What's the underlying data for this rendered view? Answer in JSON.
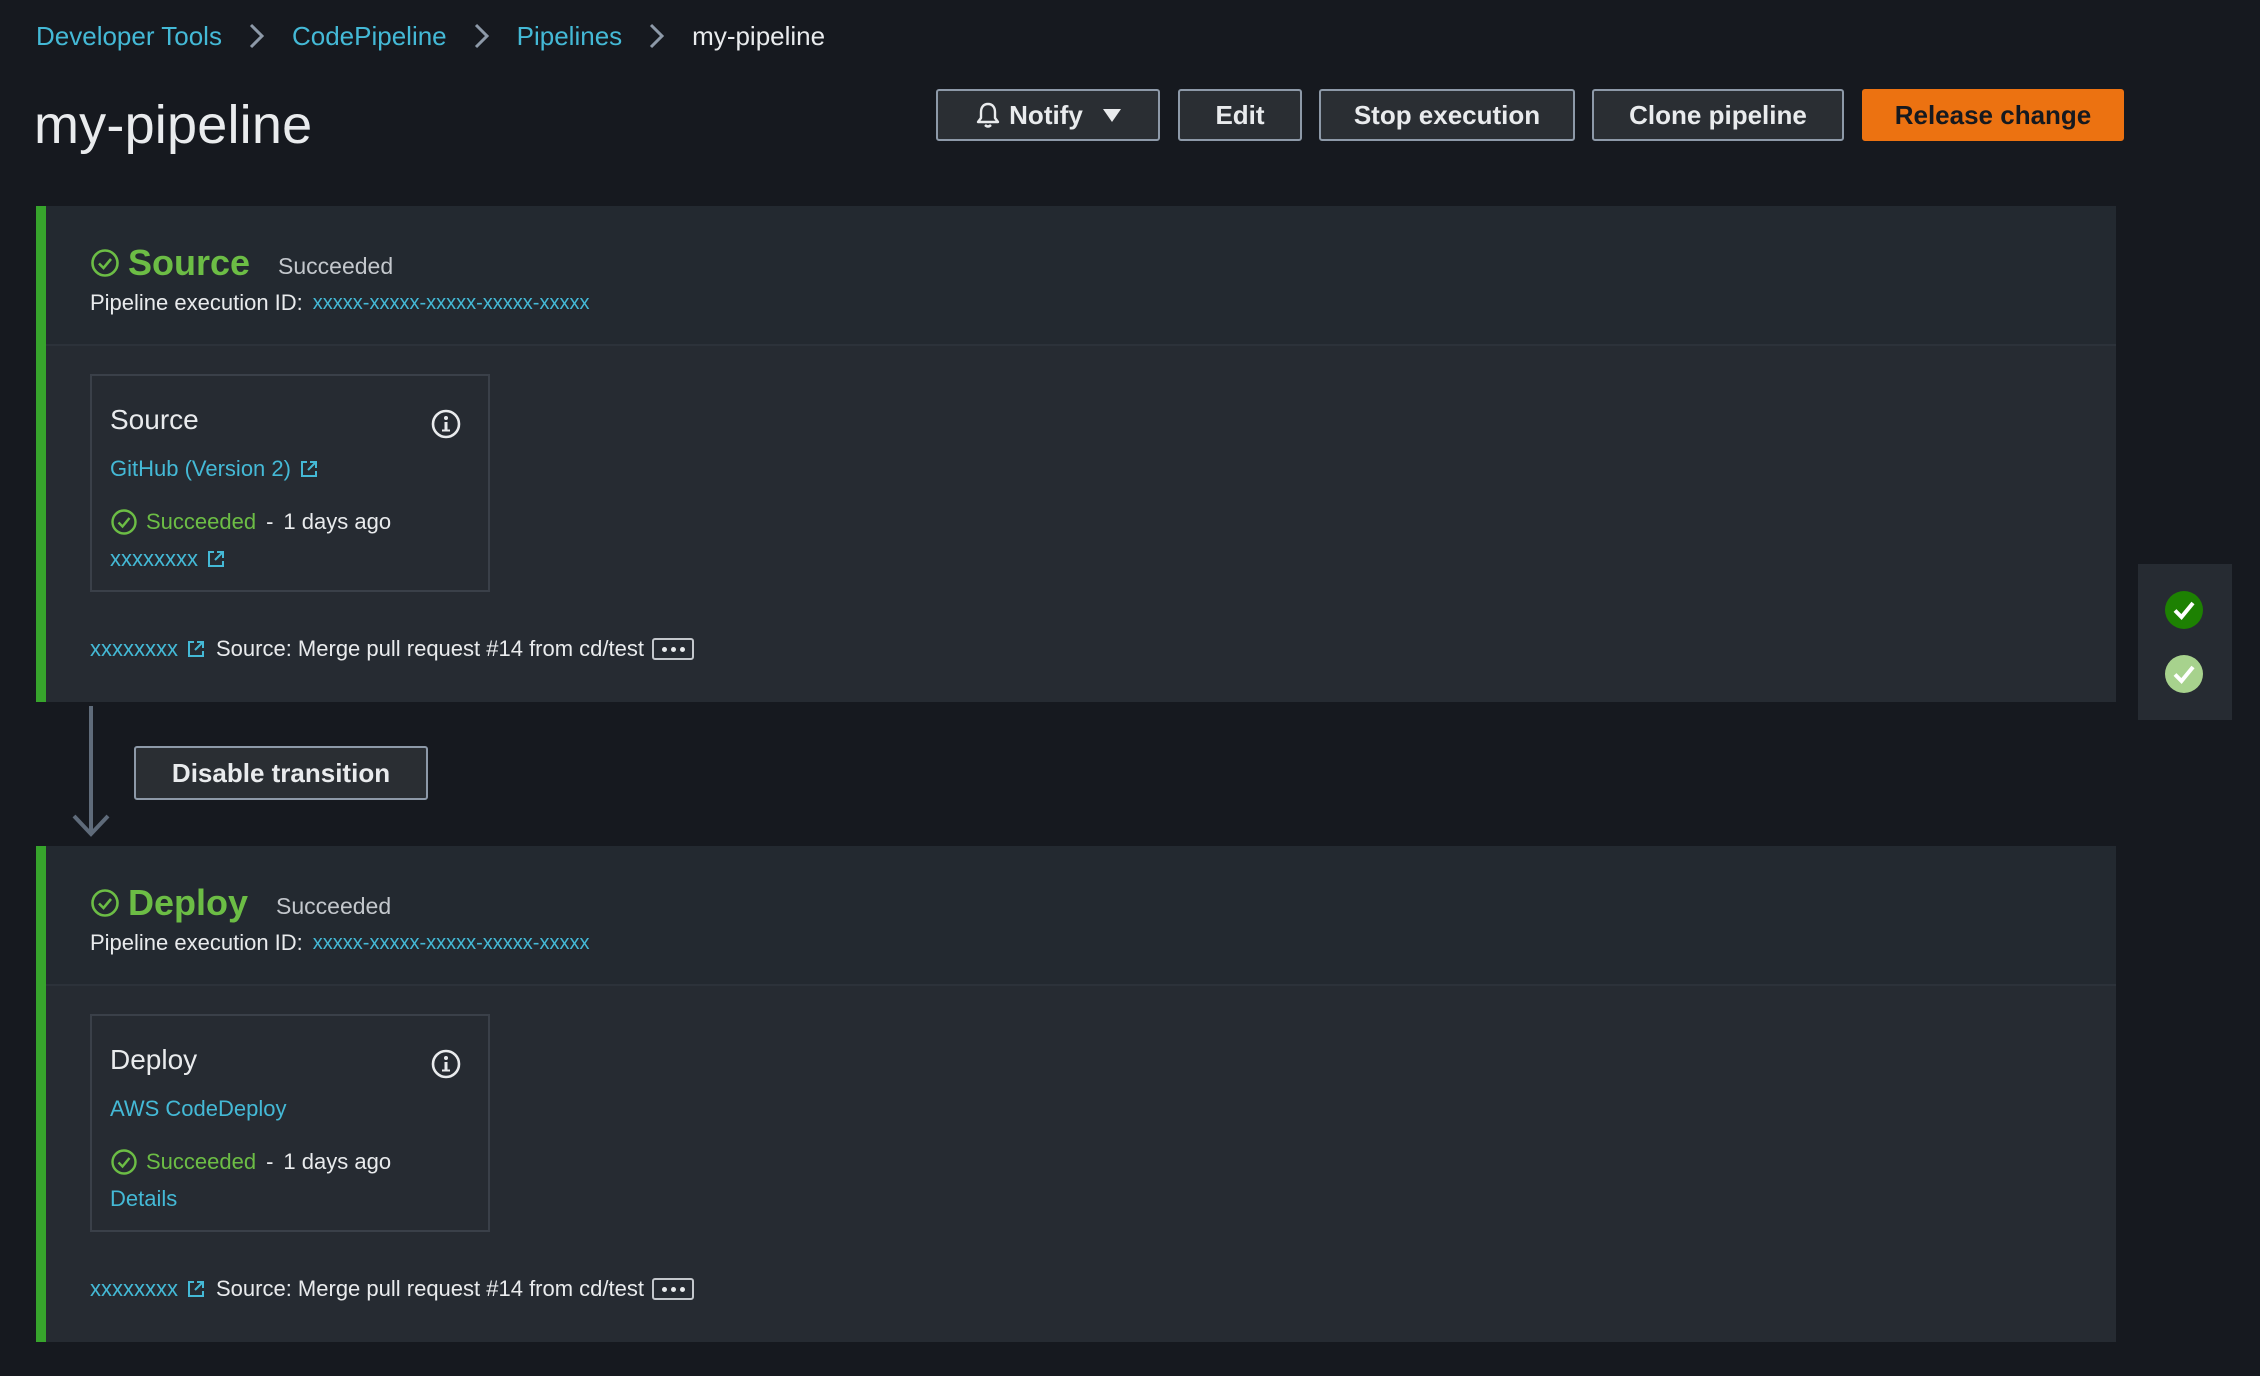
{
  "breadcrumb": {
    "items": [
      {
        "label": "Developer Tools"
      },
      {
        "label": "CodePipeline"
      },
      {
        "label": "Pipelines"
      },
      {
        "label": "my-pipeline"
      }
    ]
  },
  "page": {
    "title": "my-pipeline"
  },
  "header_buttons": {
    "notify": "Notify",
    "edit": "Edit",
    "stop": "Stop execution",
    "clone": "Clone pipeline",
    "release": "Release change"
  },
  "stages": [
    {
      "name": "Source",
      "status": "Succeeded",
      "exec_label": "Pipeline execution ID:",
      "exec_id": "xxxxx-xxxxx-xxxxx-xxxxx-xxxxx",
      "action": {
        "name": "Source",
        "provider": "GitHub (Version 2)",
        "status": "Succeeded",
        "dash": "-",
        "ago": "1 days ago",
        "link": "xxxxxxxx"
      },
      "commit": {
        "id": "xxxxxxxx",
        "message": "Source: Merge pull request #14 from cd/test"
      }
    },
    {
      "name": "Deploy",
      "status": "Succeeded",
      "exec_label": "Pipeline execution ID:",
      "exec_id": "xxxxx-xxxxx-xxxxx-xxxxx-xxxxx",
      "action": {
        "name": "Deploy",
        "provider": "AWS CodeDeploy",
        "status": "Succeeded",
        "dash": "-",
        "ago": "1 days ago",
        "link": "Details"
      },
      "commit": {
        "id": "xxxxxxxx",
        "message": "Source: Merge pull request #14 from cd/test"
      }
    }
  ],
  "transition": {
    "button": "Disable transition"
  },
  "colors": {
    "accent": "#ec7211",
    "link": "#44b9d6",
    "success": "#6cbd45",
    "stage_border": "#37a42c",
    "background": "#16191f"
  },
  "icons": {
    "breadcrumb_sep": "chevron-right-icon",
    "notify": "bell-icon",
    "notify_caret": "caret-down-icon",
    "stage_status": "check-circle-icon",
    "info": "info-icon",
    "external": "external-link-icon",
    "more": "ellipsis-icon",
    "transition": "arrow-down-icon",
    "rail": "check-circle-filled-icon"
  }
}
